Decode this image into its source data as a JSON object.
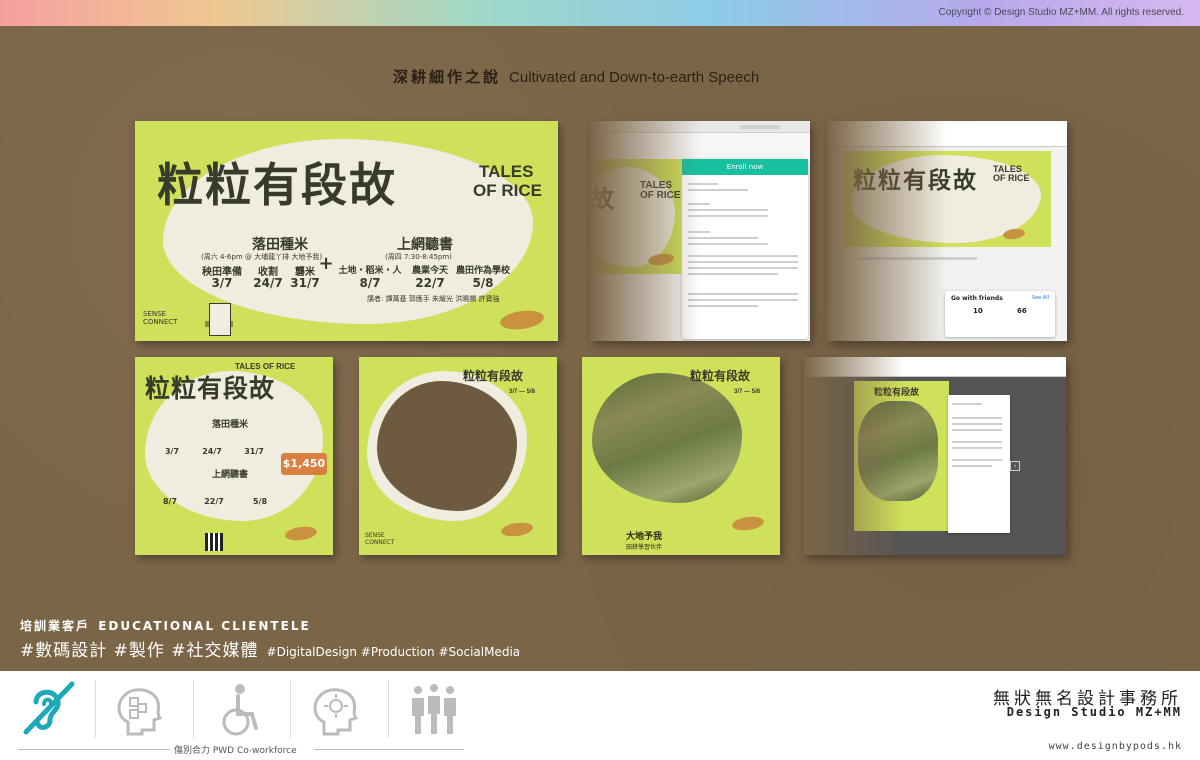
{
  "header": {
    "copyright": "Copyright © Design Studio MZ+MM. All rights reserved."
  },
  "showcase": {
    "title_zh": "深耕細作之說",
    "title_en": "Cultivated and Down-to-earth Speech"
  },
  "poster": {
    "title_zh": "粒粒有段故",
    "title_en_1": "TALES",
    "title_en_2": "OF RICE",
    "tales_combined": "TALES OF RICE",
    "section1_title": "落田種米",
    "section1_sub": "(周六 4-6pm @ 大埔龍丫排 大地予我)",
    "section1_items": [
      {
        "label": "秧田準備",
        "date": "3/7"
      },
      {
        "label": "收割",
        "date": "24/7"
      },
      {
        "label": "礱米",
        "date": "31/7"
      }
    ],
    "section2_title": "上網聽書",
    "section2_sub": "(周四 7:30-8:45pm)",
    "section2_items": [
      {
        "label": "土地・稻米・人",
        "date": "8/7"
      },
      {
        "label": "農業今天",
        "date": "22/7"
      },
      {
        "label": "農田作為學校",
        "date": "5/8"
      }
    ],
    "speakers": "講者: 譚萬基  郭應手  朱耀光  洪曉嫻  許寶強",
    "price": "$1,450",
    "date_range": "3/7 — 5/8",
    "sense_connect": "SENSE CONNECT",
    "photo_caption_zh": "大地予我",
    "photo_caption_sub": "田耕學習伙伴"
  },
  "browser": {
    "enroll": "Enroll now",
    "go_with_friends": "Go with friends",
    "see_all": "See All",
    "count1": "10",
    "count2": "66"
  },
  "footer": {
    "category_zh": "培訓業客戶",
    "category_en": "EDUCATIONAL CLIENTELE",
    "tags_zh": "#數碼設計 #製作 #社交媒體",
    "tags_en": "#DigitalDesign #Production #SocialMedia",
    "pwd_label": "傷別合力 PWD Co-workforce",
    "studio_zh": "無狀無名設計事務所",
    "studio_en": "Design Studio MZ+MM",
    "url": "www.designbypods.hk"
  },
  "icons": [
    "hearing-icon",
    "autism-icon",
    "wheelchair-icon",
    "mind-icon",
    "people-icon"
  ],
  "colors": {
    "accent": "#cfe05a",
    "background": "#7b6547",
    "bubble": "#efede0",
    "rice": "#c9923e"
  }
}
